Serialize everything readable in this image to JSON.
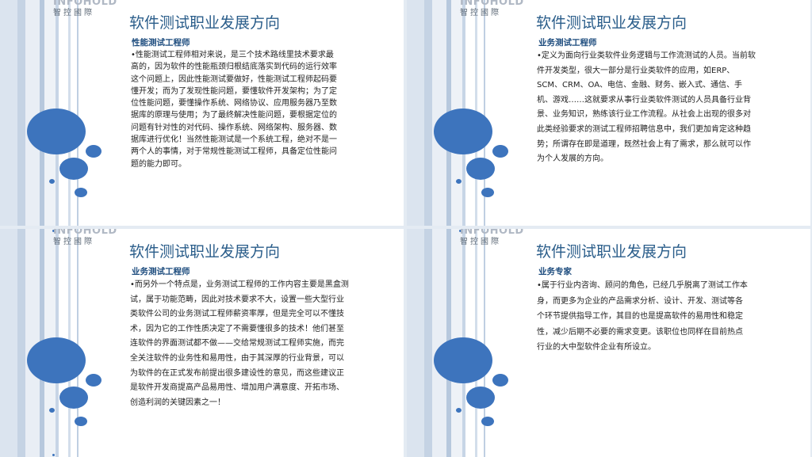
{
  "logo": {
    "en": "INFOHOLD",
    "cn": "智控國際"
  },
  "slides": [
    {
      "title": "软件测试职业发展方向",
      "subtitle": "性能测试工程师",
      "body": "•性能测试工程师相对来说，是三个技术路线里技术要求最高的，因为软件的性能瓶颈归根结底落实到代码的运行效率这个问题上，因此性能测试要做好，性能测试工程师起码要懂开发；而为了发现性能问题，要懂软件开发架构；为了定位性能问题，要懂操作系统、网络协议、应用服务器乃至数据库的原理与使用；为了最终解决性能问题，要根据定位的问题有针对性的对代码、操作系统、网络架构、服务器、数据库进行优化！当然性能测试是一个系统工程，绝对不是一两个人的事情，对于常规性能测试工程师，具备定位性能问题的能力即可。"
    },
    {
      "title": "软件测试职业发展方向",
      "subtitle": "业务测试工程师",
      "body": "•定义为面向行业类软件业务逻辑与工作流测试的人员。当前软件开发类型，很大一部分是行业类软件的应用，如ERP、SCM、CRM、OA、电信、金融、财务、嵌入式、通信、手机、游戏……这就要求从事行业类软件测试的人员具备行业背景、业务知识，熟练该行业工作流程。从社会上出现的很多对此类经验要求的测试工程师招聘信息中，我们更加肯定这种趋势；所谓存在即是道理，既然社会上有了需求，那么就可以作为个人发展的方向。"
    },
    {
      "title": "软件测试职业发展方向",
      "subtitle": "业务测试工程师",
      "body": "•而另外一个特点是，业务测试工程师的工作内容主要是黑盒测试，属于功能范畴，因此对技术要求不大，设置一些大型行业类软件公司的业务测试工程师薪资率厚，但是完全可以不懂技术，因为它的工作性质决定了不需要懂很多的技术！他们甚至连软件的界面测试都不做——交给常规测试工程师实施，而完全关注软件的业务性和易用性，由于其深厚的行业背景，可以为软件的在正式发布前提出很多建设性的意见，而这些建议正是软件开发商提高产品易用性、增加用户满意度、开拓市场、创造利润的关键因素之一！"
    },
    {
      "title": "软件测试职业发展方向",
      "subtitle": "业务专家",
      "body": "•属于行业内咨询、顾问的角色，已经几乎脱离了测试工作本身，而更多为企业的产品需求分析、设计、开发、测试等各个环节提供指导工作，其目的也是提高软件的易用性和稳定性，减少后期不必要的需求变更。该职位也同样在目前热点行业的大中型软件企业有所设立。"
    }
  ]
}
